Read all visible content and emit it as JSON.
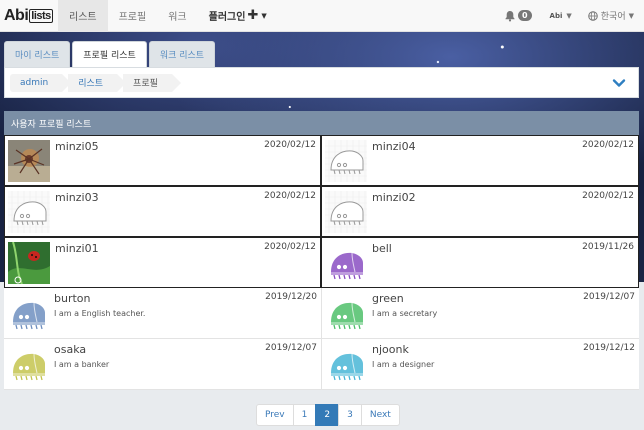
{
  "navbar": {
    "logo_main": "Abi",
    "logo_sub": "lists",
    "items": [
      {
        "label": "리스트",
        "active": true
      },
      {
        "label": "프로필",
        "active": false
      },
      {
        "label": "워크",
        "active": false
      }
    ],
    "plugin_label": "플러그인",
    "notification_count": "0",
    "user_label": "Abi",
    "language_label": "한국어"
  },
  "tabs": [
    {
      "label": "마이 리스트"
    },
    {
      "label": "프로필 리스트"
    },
    {
      "label": "워크 리스트"
    }
  ],
  "breadcrumb": [
    "admin",
    "리스트",
    "프로필"
  ],
  "panel": {
    "title": "사용자 프로필 리스트"
  },
  "profiles": [
    {
      "name": "minzi05",
      "date": "2020/02/12",
      "desc": "",
      "avatar": "spider-photo"
    },
    {
      "name": "minzi04",
      "date": "2020/02/12",
      "desc": "",
      "avatar": "outline-bug"
    },
    {
      "name": "minzi03",
      "date": "2020/02/12",
      "desc": "",
      "avatar": "outline-bug"
    },
    {
      "name": "minzi02",
      "date": "2020/02/12",
      "desc": "",
      "avatar": "outline-bug"
    },
    {
      "name": "minzi01",
      "date": "2020/02/12",
      "desc": "",
      "avatar": "ladybug-photo"
    },
    {
      "name": "bell",
      "date": "2019/11/26",
      "desc": "",
      "avatar": "bug",
      "color": "#8a4fc2"
    },
    {
      "name": "burton",
      "date": "2019/12/20",
      "desc": "I am a English teacher.",
      "avatar": "bug",
      "color": "#6f8fbf"
    },
    {
      "name": "green",
      "date": "2019/12/07",
      "desc": "I am a secretary",
      "avatar": "bug",
      "color": "#4fbf6a"
    },
    {
      "name": "osaka",
      "date": "2019/12/07",
      "desc": "I am a banker",
      "avatar": "bug",
      "color": "#c4c44f"
    },
    {
      "name": "njoonk",
      "date": "2019/12/12",
      "desc": "I am a designer",
      "avatar": "bug",
      "color": "#49b6d6"
    }
  ],
  "pagination": {
    "prev": "Prev",
    "pages": [
      "1",
      "2",
      "3"
    ],
    "active": "2",
    "next": "Next"
  },
  "colors": {
    "panel_header": "#7b8fa6",
    "primary": "#337ab7",
    "link": "#3a79b8"
  }
}
